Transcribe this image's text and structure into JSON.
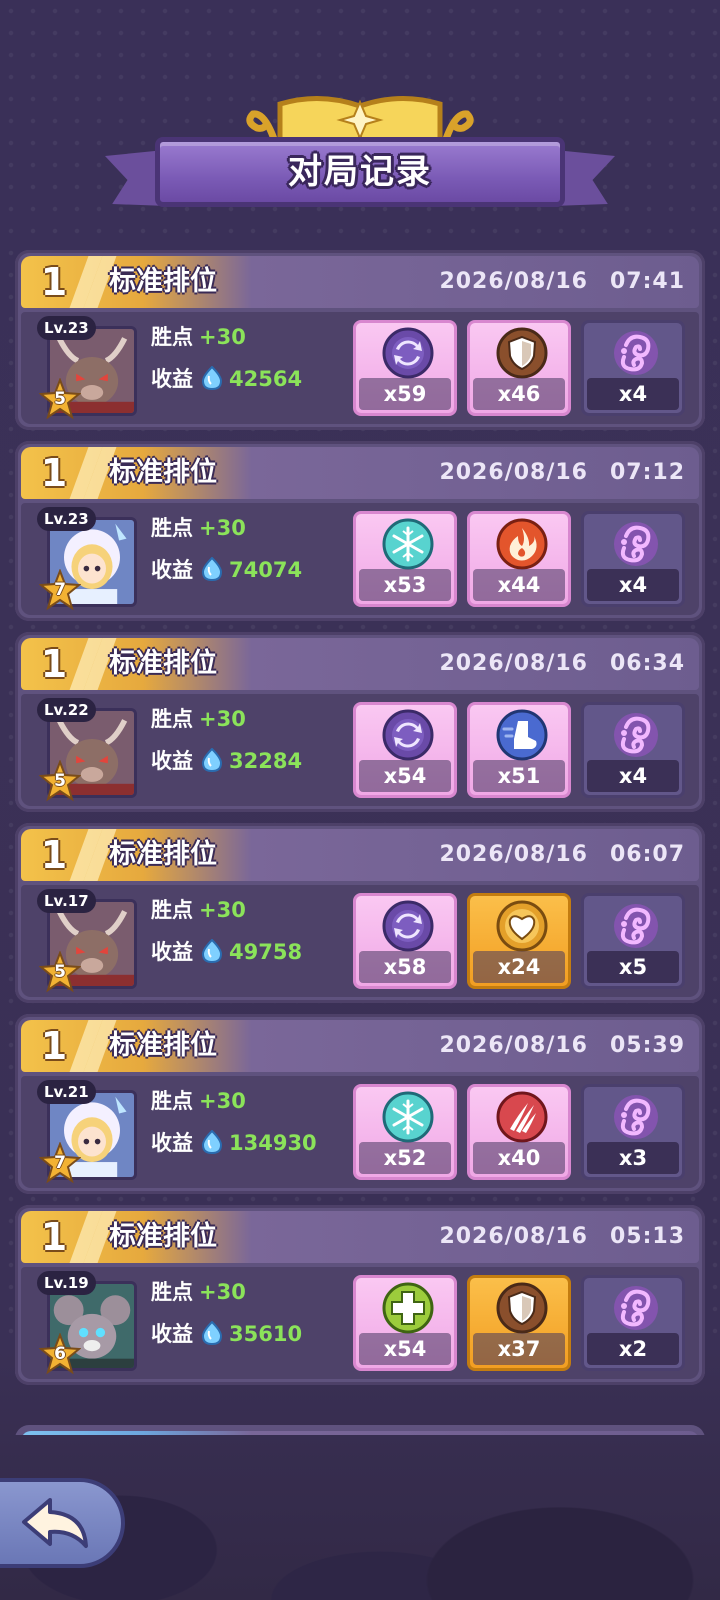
{
  "title": "对局记录",
  "records": [
    {
      "rank": "1",
      "mode": "标准排位",
      "date": "2026/08/16",
      "time": "07:41",
      "level": "Lv.23",
      "stars": "5",
      "hero": "deer",
      "points_label": "胜点",
      "points": "+30",
      "income_label": "收益",
      "income": "42564",
      "items": [
        {
          "style": "pink",
          "icon": "cycle-orb-icon",
          "count": "x59"
        },
        {
          "style": "pink",
          "icon": "shield-orb-icon",
          "count": "x46"
        },
        {
          "style": "dark",
          "icon": "purple-swirl-icon",
          "count": "x4"
        }
      ]
    },
    {
      "rank": "1",
      "mode": "标准排位",
      "date": "2026/08/16",
      "time": "07:12",
      "level": "Lv.23",
      "stars": "7",
      "hero": "girl",
      "points_label": "胜点",
      "points": "+30",
      "income_label": "收益",
      "income": "74074",
      "items": [
        {
          "style": "pink",
          "icon": "snowflake-orb-icon",
          "count": "x53"
        },
        {
          "style": "pink",
          "icon": "flame-orb-icon",
          "count": "x44"
        },
        {
          "style": "dark",
          "icon": "purple-swirl-icon",
          "count": "x4"
        }
      ]
    },
    {
      "rank": "1",
      "mode": "标准排位",
      "date": "2026/08/16",
      "time": "06:34",
      "level": "Lv.22",
      "stars": "5",
      "hero": "deer",
      "points_label": "胜点",
      "points": "+30",
      "income_label": "收益",
      "income": "32284",
      "items": [
        {
          "style": "pink",
          "icon": "cycle-orb-icon",
          "count": "x54"
        },
        {
          "style": "pink",
          "icon": "boot-orb-icon",
          "count": "x51"
        },
        {
          "style": "dark",
          "icon": "purple-swirl-icon",
          "count": "x4"
        }
      ]
    },
    {
      "rank": "1",
      "mode": "标准排位",
      "date": "2026/08/16",
      "time": "06:07",
      "level": "Lv.17",
      "stars": "5",
      "hero": "deer",
      "points_label": "胜点",
      "points": "+30",
      "income_label": "收益",
      "income": "49758",
      "items": [
        {
          "style": "pink",
          "icon": "cycle-orb-icon",
          "count": "x58"
        },
        {
          "style": "gold",
          "icon": "heart-orb-icon",
          "count": "x24"
        },
        {
          "style": "dark",
          "icon": "purple-swirl-icon",
          "count": "x5"
        }
      ]
    },
    {
      "rank": "1",
      "mode": "标准排位",
      "date": "2026/08/16",
      "time": "05:39",
      "level": "Lv.21",
      "stars": "7",
      "hero": "girl",
      "points_label": "胜点",
      "points": "+30",
      "income_label": "收益",
      "income": "134930",
      "items": [
        {
          "style": "pink",
          "icon": "snowflake-orb-icon",
          "count": "x52"
        },
        {
          "style": "pink",
          "icon": "claw-orb-icon",
          "count": "x40"
        },
        {
          "style": "dark",
          "icon": "purple-swirl-icon",
          "count": "x3"
        }
      ]
    },
    {
      "rank": "1",
      "mode": "标准排位",
      "date": "2026/08/16",
      "time": "05:13",
      "level": "Lv.19",
      "stars": "6",
      "hero": "mouse",
      "points_label": "胜点",
      "points": "+30",
      "income_label": "收益",
      "income": "35610",
      "items": [
        {
          "style": "pink",
          "icon": "cross-orb-icon",
          "count": "x54"
        },
        {
          "style": "gold",
          "icon": "shield-orb-icon",
          "count": "x37"
        },
        {
          "style": "dark",
          "icon": "purple-swirl-icon",
          "count": "x2"
        }
      ]
    }
  ],
  "colors": {
    "positive": "#8be35a",
    "gold_header": "#f3c24a",
    "card_bg": "#5f527e"
  },
  "back_icon": "back-arrow-icon"
}
